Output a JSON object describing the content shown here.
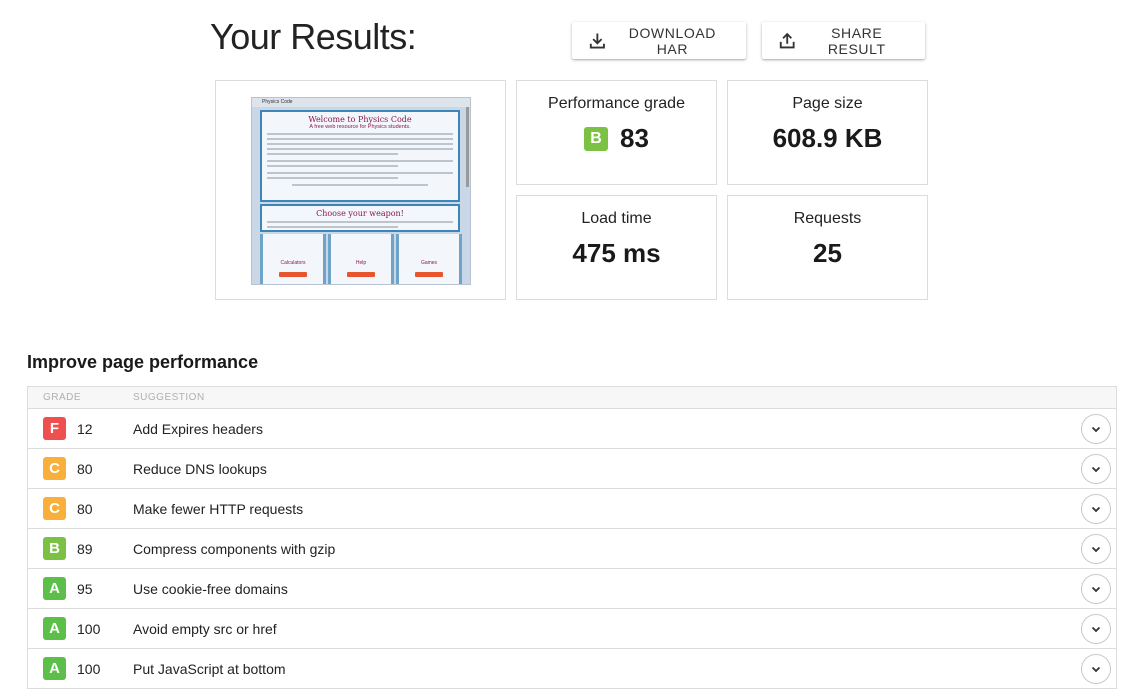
{
  "header": {
    "title": "Your Results:"
  },
  "toolbar": {
    "download_label": "DOWNLOAD HAR",
    "share_label": "SHARE RESULT"
  },
  "thumbnail": {
    "site_name": "Physics Code",
    "heading": "Welcome to Physics Code",
    "subheading": "A free web resource for Physics students.",
    "section_heading": "Choose your weapon!",
    "columns": [
      "Calculators",
      "Help",
      "Games"
    ]
  },
  "metrics": {
    "grade": {
      "label": "Performance grade",
      "letter": "B",
      "value": "83",
      "color": "#7bc144"
    },
    "size": {
      "label": "Page size",
      "value": "608.9 KB"
    },
    "load": {
      "label": "Load time",
      "value": "475 ms"
    },
    "requests": {
      "label": "Requests",
      "value": "25"
    }
  },
  "improve": {
    "title": "Improve page performance",
    "columns": {
      "grade": "GRADE",
      "suggestion": "SUGGESTION"
    },
    "rows": [
      {
        "letter": "F",
        "score": "12",
        "suggestion": "Add Expires headers",
        "color": "#ef4f4f"
      },
      {
        "letter": "C",
        "score": "80",
        "suggestion": "Reduce DNS lookups",
        "color": "#f9b03a"
      },
      {
        "letter": "C",
        "score": "80",
        "suggestion": "Make fewer HTTP requests",
        "color": "#f9b03a"
      },
      {
        "letter": "B",
        "score": "89",
        "suggestion": "Compress components with gzip",
        "color": "#7bc144"
      },
      {
        "letter": "A",
        "score": "95",
        "suggestion": "Use cookie-free domains",
        "color": "#5cbf4a"
      },
      {
        "letter": "A",
        "score": "100",
        "suggestion": "Avoid empty src or href",
        "color": "#5cbf4a"
      },
      {
        "letter": "A",
        "score": "100",
        "suggestion": "Put JavaScript at bottom",
        "color": "#5cbf4a"
      }
    ]
  }
}
